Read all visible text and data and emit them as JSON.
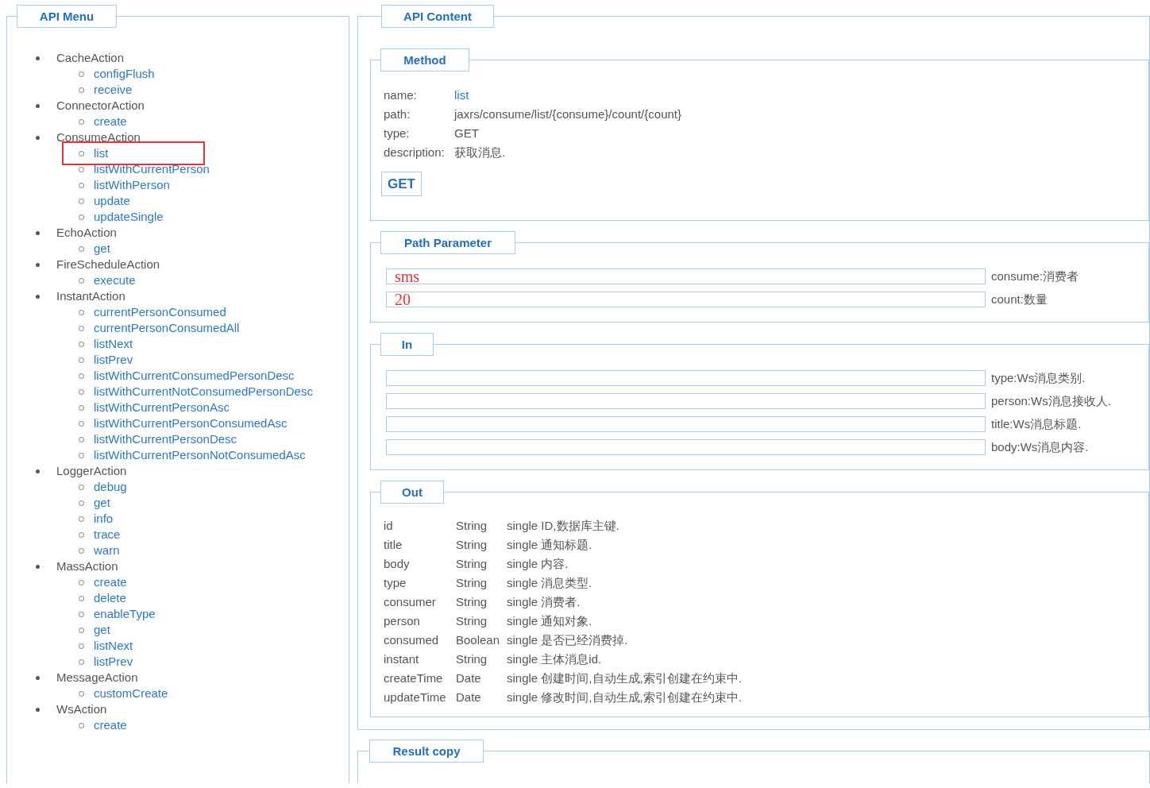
{
  "menu": {
    "title": "API Menu",
    "groups": [
      {
        "name": "CacheAction",
        "items": [
          {
            "label": "configFlush",
            "selected": false
          },
          {
            "label": "receive",
            "selected": false
          }
        ]
      },
      {
        "name": "ConnectorAction",
        "items": [
          {
            "label": "create",
            "selected": false
          }
        ]
      },
      {
        "name": "ConsumeAction",
        "items": [
          {
            "label": "list",
            "selected": true
          },
          {
            "label": "listWithCurrentPerson",
            "selected": false
          },
          {
            "label": "listWithPerson",
            "selected": false
          },
          {
            "label": "update",
            "selected": false
          },
          {
            "label": "updateSingle",
            "selected": false
          }
        ]
      },
      {
        "name": "EchoAction",
        "items": [
          {
            "label": "get",
            "selected": false
          }
        ]
      },
      {
        "name": "FireScheduleAction",
        "items": [
          {
            "label": "execute",
            "selected": false
          }
        ]
      },
      {
        "name": "InstantAction",
        "items": [
          {
            "label": "currentPersonConsumed",
            "selected": false
          },
          {
            "label": "currentPersonConsumedAll",
            "selected": false
          },
          {
            "label": "listNext",
            "selected": false
          },
          {
            "label": "listPrev",
            "selected": false
          },
          {
            "label": "listWithCurrentConsumedPersonDesc",
            "selected": false
          },
          {
            "label": "listWithCurrentNotConsumedPersonDesc",
            "selected": false
          },
          {
            "label": "listWithCurrentPersonAsc",
            "selected": false
          },
          {
            "label": "listWithCurrentPersonConsumedAsc",
            "selected": false
          },
          {
            "label": "listWithCurrentPersonDesc",
            "selected": false
          },
          {
            "label": "listWithCurrentPersonNotConsumedAsc",
            "selected": false
          }
        ]
      },
      {
        "name": "LoggerAction",
        "items": [
          {
            "label": "debug",
            "selected": false
          },
          {
            "label": "get",
            "selected": false
          },
          {
            "label": "info",
            "selected": false
          },
          {
            "label": "trace",
            "selected": false
          },
          {
            "label": "warn",
            "selected": false
          }
        ]
      },
      {
        "name": "MassAction",
        "items": [
          {
            "label": "create",
            "selected": false
          },
          {
            "label": "delete",
            "selected": false
          },
          {
            "label": "enableType",
            "selected": false
          },
          {
            "label": "get",
            "selected": false
          },
          {
            "label": "listNext",
            "selected": false
          },
          {
            "label": "listPrev",
            "selected": false
          }
        ]
      },
      {
        "name": "MessageAction",
        "items": [
          {
            "label": "customCreate",
            "selected": false
          }
        ]
      },
      {
        "name": "WsAction",
        "items": [
          {
            "label": "create",
            "selected": false
          }
        ]
      }
    ]
  },
  "content": {
    "title": "API Content",
    "method": {
      "title": "Method",
      "fields": [
        {
          "label": "name:",
          "value": "list",
          "kind": "link"
        },
        {
          "label": "path:",
          "value": "jaxrs/consume/list/{consume}/count/{count}",
          "kind": "text"
        },
        {
          "label": "type:",
          "value": "GET",
          "kind": "text"
        },
        {
          "label": "description:",
          "value": "获取消息.",
          "kind": "text"
        }
      ],
      "button": "GET"
    },
    "path_parameter": {
      "title": "Path Parameter",
      "params": [
        {
          "value": "sms",
          "label": "consume:消费者"
        },
        {
          "value": "20",
          "label": "count:数量"
        }
      ]
    },
    "in": {
      "title": "In",
      "params": [
        {
          "label": "type:Ws消息类别."
        },
        {
          "label": "person:Ws消息接收人."
        },
        {
          "label": "title:Ws消息标题."
        },
        {
          "label": "body:Ws消息内容."
        }
      ]
    },
    "out": {
      "title": "Out",
      "rows": [
        {
          "name": "id",
          "type": "String",
          "description": "single ID,数据库主键."
        },
        {
          "name": "title",
          "type": "String",
          "description": "single 通知标题."
        },
        {
          "name": "body",
          "type": "String",
          "description": "single 内容."
        },
        {
          "name": "type",
          "type": "String",
          "description": "single 消息类型."
        },
        {
          "name": "consumer",
          "type": "String",
          "description": "single 消费者."
        },
        {
          "name": "person",
          "type": "String",
          "description": "single 通知对象."
        },
        {
          "name": "consumed",
          "type": "Boolean",
          "description": "single 是否已经消费掉."
        },
        {
          "name": "instant",
          "type": "String",
          "description": "single 主体消息id."
        },
        {
          "name": "createTime",
          "type": "Date",
          "description": "single 创建时间,自动生成,索引创建在约束中."
        },
        {
          "name": "updateTime",
          "type": "Date",
          "description": "single 修改时间,自动生成,索引创建在约束中."
        }
      ]
    }
  },
  "result": {
    "title": "Result copy"
  }
}
